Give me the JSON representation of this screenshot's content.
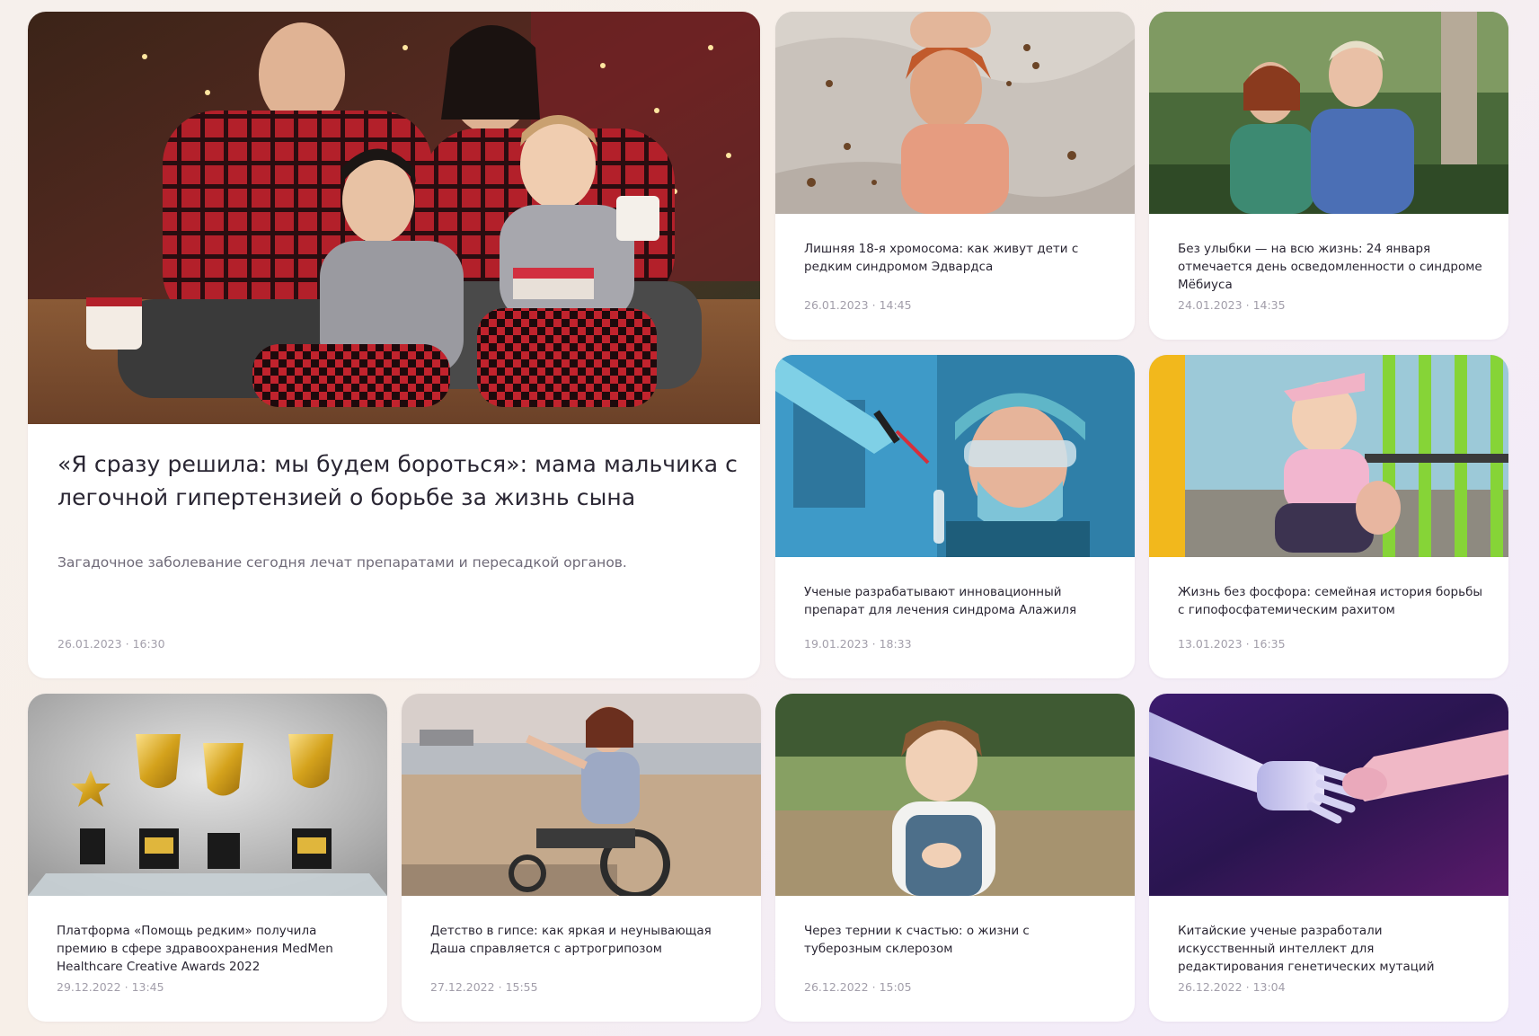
{
  "colors": {
    "card_background": "#ffffff",
    "title_text": "#2a2633",
    "excerpt_text": "#6f6a78",
    "date_text": "#a29eaa"
  },
  "separator": "·",
  "featured": {
    "title": "«Я сразу решила: мы будем бороться»: мама мальчика с легочной гипертензией о борьбе за жизнь сына",
    "excerpt": "Загадочное заболевание сегодня лечат препаратами и пересадкой органов.",
    "date": "26.01.2023",
    "time": "16:30"
  },
  "articles": [
    {
      "title": "Лишняя 18-я хромосома: как живут дети с редким синдромом Эдвардса",
      "date": "26.01.2023",
      "time": "14:45"
    },
    {
      "title": "Без улыбки — на всю жизнь: 24 января отмечается день осведомленности о синдроме Мёбиуса",
      "date": "24.01.2023",
      "time": "14:35"
    },
    {
      "title": "Ученые разрабатывают инновационный препарат для лечения синдрома Алажиля",
      "date": "19.01.2023",
      "time": "18:33"
    },
    {
      "title": "Жизнь без фосфора: семейная история борьбы с гипофосфатемическим рахитом",
      "date": "13.01.2023",
      "time": "16:35"
    },
    {
      "title": "Платформа «Помощь редким» получила премию в сфере здравоохранения MedMen Healthcare Creative Awards 2022",
      "date": "29.12.2022",
      "time": "13:45"
    },
    {
      "title": "Детство в гипсе: как яркая и неунывающая Даша справляется с артрогрипозом",
      "date": "27.12.2022",
      "time": "15:55"
    },
    {
      "title": "Через тернии к счастью: о жизни с туберозным склерозом",
      "date": "26.12.2022",
      "time": "15:05"
    },
    {
      "title": "Китайские ученые разработали искусственный интеллект для редактирования генетических мутаций",
      "date": "26.12.2022",
      "time": "13:04"
    }
  ]
}
